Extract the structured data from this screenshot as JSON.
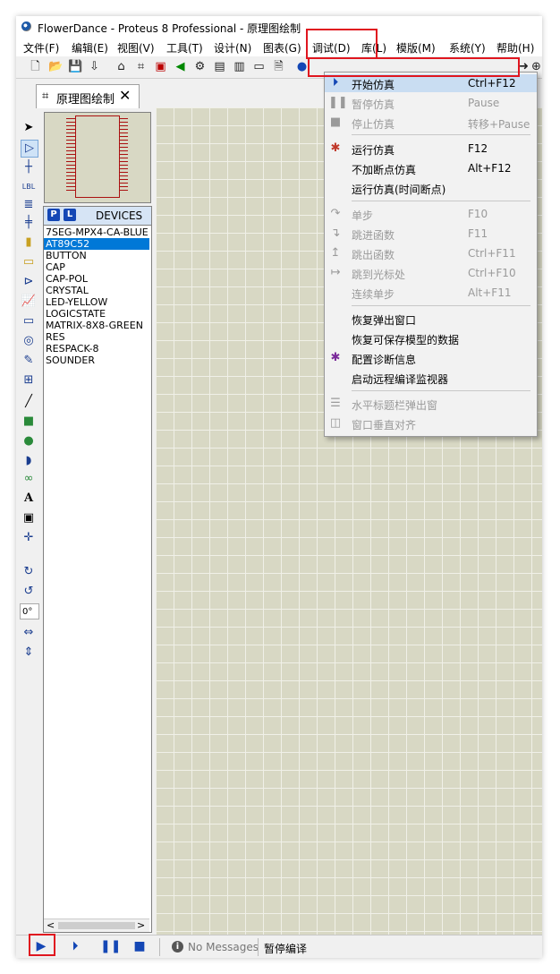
{
  "window": {
    "title": "FlowerDance - Proteus 8 Professional - 原理图绘制"
  },
  "menubar": [
    "文件(F)",
    "编辑(E)",
    "视图(V)",
    "工具(T)",
    "设计(N)",
    "图表(G)",
    "调试(D)",
    "库(L)",
    "模版(M)",
    "系统(Y)",
    "帮助(H)"
  ],
  "tab": {
    "label": "原理图绘制",
    "close": "✕"
  },
  "device_panel": {
    "p_label": "P",
    "l_label": "L",
    "header": "DEVICES",
    "items": [
      "7SEG-MPX4-CA-BLUE",
      "AT89C52",
      "BUTTON",
      "CAP",
      "CAP-POL",
      "CRYSTAL",
      "LED-YELLOW",
      "LOGICSTATE",
      "MATRIX-8X8-GREEN",
      "RES",
      "RESPACK-8",
      "SOUNDER"
    ],
    "selected": "AT89C52",
    "scroll_left": "<",
    "scroll_right": ">"
  },
  "left_toolbar": {
    "angle": "0°"
  },
  "debug_menu": {
    "items": [
      {
        "label": "开始仿真",
        "shortcut": "Ctrl+F12",
        "enabled": true,
        "icon": "start-debug-icon"
      },
      {
        "label": "暂停仿真",
        "shortcut": "Pause",
        "enabled": false,
        "icon": "pause-icon"
      },
      {
        "label": "停止仿真",
        "shortcut": "转移+Pause",
        "enabled": false,
        "icon": "stop-icon"
      },
      {
        "label": "运行仿真",
        "shortcut": "F12",
        "enabled": true,
        "icon": "run-bug-icon"
      },
      {
        "label": "不加断点仿真",
        "shortcut": "Alt+F12",
        "enabled": true,
        "icon": ""
      },
      {
        "label": "运行仿真(时间断点)",
        "shortcut": "",
        "enabled": true,
        "icon": ""
      },
      {
        "label": "单步",
        "shortcut": "F10",
        "enabled": false,
        "icon": "step-icon"
      },
      {
        "label": "跳进函数",
        "shortcut": "F11",
        "enabled": false,
        "icon": "step-into-icon"
      },
      {
        "label": "跳出函数",
        "shortcut": "Ctrl+F11",
        "enabled": false,
        "icon": "step-out-icon"
      },
      {
        "label": "跳到光标处",
        "shortcut": "Ctrl+F10",
        "enabled": false,
        "icon": "run-to-cursor-icon"
      },
      {
        "label": "连续单步",
        "shortcut": "Alt+F11",
        "enabled": false,
        "icon": ""
      },
      {
        "label": "恢复弹出窗口",
        "shortcut": "",
        "enabled": true,
        "icon": ""
      },
      {
        "label": "恢复可保存模型的数据",
        "shortcut": "",
        "enabled": true,
        "icon": ""
      },
      {
        "label": "配置诊断信息",
        "shortcut": "",
        "enabled": true,
        "icon": "diagnostics-bug-icon"
      },
      {
        "label": "启动远程编译监视器",
        "shortcut": "",
        "enabled": true,
        "icon": ""
      },
      {
        "label": "水平标题栏弹出窗",
        "shortcut": "",
        "enabled": false,
        "icon": "tile-horizontal-icon"
      },
      {
        "label": "窗口垂直对齐",
        "shortcut": "",
        "enabled": false,
        "icon": "tile-vertical-icon"
      }
    ]
  },
  "statusbar": {
    "messages": "No Messages",
    "state": "暂停编译"
  },
  "colors": {
    "highlight": "#e0161f",
    "menu_hover": "#c9ddf2",
    "selection": "#0078d7",
    "canvas": "#d8d8c4"
  }
}
